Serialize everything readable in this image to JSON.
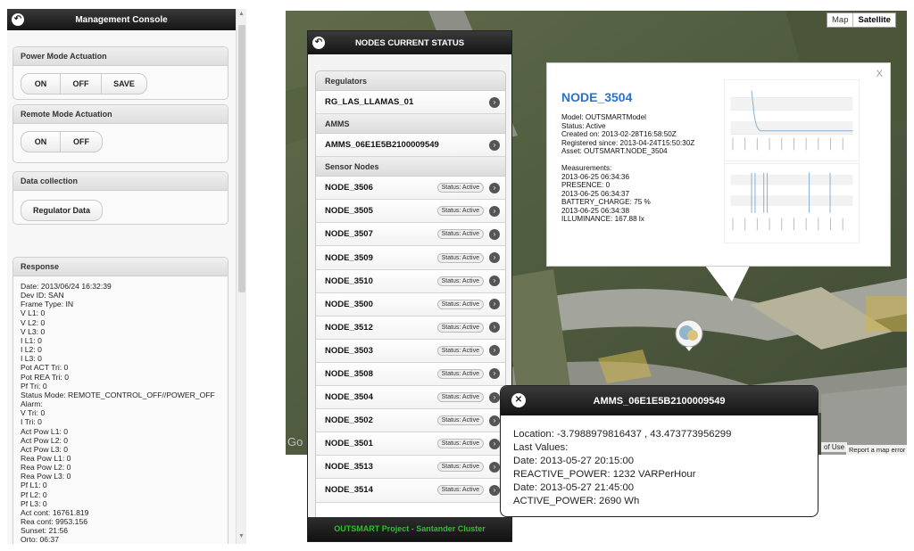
{
  "management": {
    "title": "Management Console",
    "power_mode": {
      "title": "Power Mode Actuation",
      "on": "ON",
      "off": "OFF",
      "save": "SAVE"
    },
    "remote_mode": {
      "title": "Remote Mode Actuation",
      "on": "ON",
      "off": "OFF"
    },
    "data_collection": {
      "title": "Data collection",
      "button": "Regulator Data"
    },
    "response": {
      "title": "Response",
      "lines": [
        "Date: 2013/06/24 16:32:39",
        "Dev ID: SAN",
        "Frame Type: IN",
        "V L1: 0",
        "V L2: 0",
        "V L3: 0",
        "I L1: 0",
        "I L2: 0",
        "I L3: 0",
        "Pot ACT Tri: 0",
        "Pot REA Tri: 0",
        "Pf Tri: 0",
        "Status Mode: REMOTE_CONTROL_OFF//POWER_OFF",
        "Alarm:",
        "V Tri: 0",
        "I Tri: 0",
        "Act Pow L1: 0",
        "Act Pow L2: 0",
        "Act Pow L3: 0",
        "Rea Pow L1: 0",
        "Rea Pow L2: 0",
        "Rea Pow L3: 0",
        "Pf L1: 0",
        "Pf L2: 0",
        "Pf L3: 0",
        "Act cont: 16761.819",
        "Rea cont: 9953.156",
        "Sunset: 21:56",
        "Orto: 06:37"
      ]
    }
  },
  "map": {
    "map_button": "Map",
    "satellite_button": "Satellite",
    "terms": "of Use",
    "report": "Report a map error",
    "google": "Go"
  },
  "nodes": {
    "title": "NODES CURRENT STATUS",
    "regulators_title": "Regulators",
    "regulators": [
      "RG_LAS_LLAMAS_01"
    ],
    "amms_title": "AMMS",
    "amms": [
      "AMMS_06E1E5B2100009549"
    ],
    "sensor_title": "Sensor Nodes",
    "status_label": "Status: Active",
    "sensors": [
      "NODE_3506",
      "NODE_3505",
      "NODE_3507",
      "NODE_3509",
      "NODE_3510",
      "NODE_3500",
      "NODE_3512",
      "NODE_3503",
      "NODE_3508",
      "NODE_3504",
      "NODE_3502",
      "NODE_3501",
      "NODE_3513",
      "NODE_3514"
    ],
    "footer": "OUTSMART Project - Santander Cluster"
  },
  "node_popup": {
    "title": "NODE_3504",
    "close": "X",
    "lines_a": [
      "Model: OUTSMARTModel",
      "Status: Active",
      "Created on: 2013-02-28T16:58:50Z",
      "Registered since: 2013-04-24T15:50:30Z",
      "Asset: OUTSMART.NODE_3504"
    ],
    "lines_b": [
      "Measurements:",
      "2013-06-25 06:34:36",
      "PRESENCE: 0",
      "2013-06-25 06:34:37",
      "BATTERY_CHARGE: 75 %",
      "2013-06-25 06:34:38",
      "ILLUMINANCE: 167.88 lx"
    ]
  },
  "amms_popup": {
    "title": "AMMS_06E1E5B2100009549",
    "close": "✕",
    "lines": [
      "Location: -3.7988979816437 , 43.473773956299",
      "Last Values:",
      "Date: 2013-05-27 20:15:00",
      "REACTIVE_POWER: 1232 VARPerHour",
      "Date: 2013-05-27 21:45:00",
      "ACTIVE_POWER: 2690 Wh"
    ]
  },
  "icons": {
    "back": "back-arrow-icon",
    "chevron": "chevron-right-icon",
    "marker": "map-marker-icon"
  }
}
